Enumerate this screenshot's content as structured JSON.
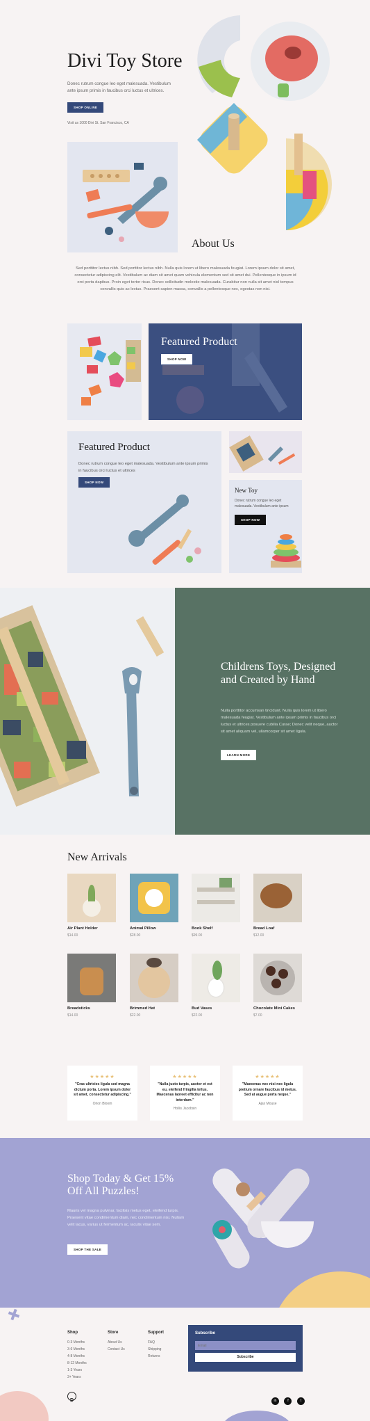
{
  "hero": {
    "title": "Divi Toy Store",
    "text": "Donec rutrum congue leo eget malesuada. Vestibulum ante ipsum primis in faucibus orci luctus et ultrices.",
    "cta": "Shop Online",
    "address": "Visit us 1000 Divi St. San Francisco, CA"
  },
  "about": {
    "title": "About Us",
    "text": "Sed porttitor lectus nibh. Sed porttitor lectus nibh. Nulla quis lorem ut libero malesuada feugiat. Lorem ipsum dolor sit amet, consectetur adipiscing elit. Vestibulum ac diam sit amet quam vehicula elementum sed sit amet dui. Pellentesque in ipsum id orci porta dapibus. Proin eget tortor risus. Donec sollicitudin molestie malesuada. Curabitur non nulla sit amet nisl tempus convallis quis ac lectus. Praesent sapien massa, convallis a pellentesque nec, egestas non nisi."
  },
  "featured1": {
    "title": "Featured Product",
    "cta": "Shop Now"
  },
  "featured2": {
    "title": "Featured Product",
    "text": "Donec rutrum congue leo eget malesuada. Vestibulum ante ipsum primis in faucibus orci luctus et ultrices",
    "cta": "Shop Now"
  },
  "newtoy": {
    "title": "New Toy",
    "text": "Donec rutrum congue leo eget malesuada. Vestibulum ante ipsum",
    "cta": "Shop Now"
  },
  "childrens": {
    "title": "Childrens Toys, Designed and Created by Hand",
    "text": "Nulla porttitor accumsan tincidunt. Nulla quis lorem ut libero malesuada feugiat. Vestibulum ante ipsum primis in faucibus orci luctus et ultrices posuere cubilia Curae; Donec velit neque, auctor sit amet aliquam vel, ullamcorper sit amet ligula.",
    "cta": "Learn More"
  },
  "arrivals": {
    "title": "New Arrivals",
    "products": [
      {
        "name": "Air Plant Holder",
        "price": "$14.00"
      },
      {
        "name": "Animal Pillow",
        "price": "$28.00"
      },
      {
        "name": "Book Shelf",
        "price": "$99.00"
      },
      {
        "name": "Bread Loaf",
        "price": "$12.00"
      },
      {
        "name": "Breadsticks",
        "price": "$14.00"
      },
      {
        "name": "Brimmed Hat",
        "price": "$22.00"
      },
      {
        "name": "Bud Vases",
        "price": "$22.00"
      },
      {
        "name": "Chocolate Mini Cakes",
        "price": "$7.00"
      }
    ]
  },
  "testimonials": [
    {
      "stars": "★★★★★",
      "quote": "\"Cras ultricies ligula sed magna dictum porta. Lorem ipsum dolor sit amet, consectetur adipiscing.\"",
      "author": "Orion Bloom"
    },
    {
      "stars": "★★★★★",
      "quote": "\"Nulla justo turpis, auctor et est eu, eleifend fringilla tellus. Maecenas laoreet efficitur ac non interdum.\"",
      "author": "Hollis Jacobsin"
    },
    {
      "stars": "★★★★★",
      "quote": "\"Maecenas nec nisi nec ligula pretium ornare faucibus id metus. Sed at augue porta neque.\"",
      "author": "Ajax Mouse"
    }
  ],
  "promo": {
    "title": "Shop Today & Get 15% Off All Puzzles!",
    "text": "Mauris vel magna pulvinar, facilisis metus eget, eleifend turpis. Praesent vitae condimentum diam, nec condimentum nisi. Nullam velit lacus, varius ut fermentum ac, iaculis vitae sem.",
    "cta": "Shop The Sale"
  },
  "footer": {
    "shop": {
      "title": "Shop",
      "items": [
        "0-3 Months",
        "3-6 Months",
        "4-8 Months",
        "8-12 Months",
        "1-3 Years",
        "3+ Years"
      ]
    },
    "store": {
      "title": "Store",
      "items": [
        "About Us",
        "Contact Us"
      ]
    },
    "support": {
      "title": "Support",
      "items": [
        "FAQ",
        "Shipping",
        "Returns"
      ]
    },
    "subscribe": {
      "title": "Subscribe",
      "placeholder": "Email",
      "button": "Subscribe"
    },
    "logo": "D",
    "social": [
      "in",
      "f",
      "t"
    ]
  },
  "colors": {
    "navy": "#34497a",
    "green": "#587264",
    "lavender": "#a2a3d3",
    "yellow": "#f4cf85",
    "accent": "#e8c077"
  }
}
